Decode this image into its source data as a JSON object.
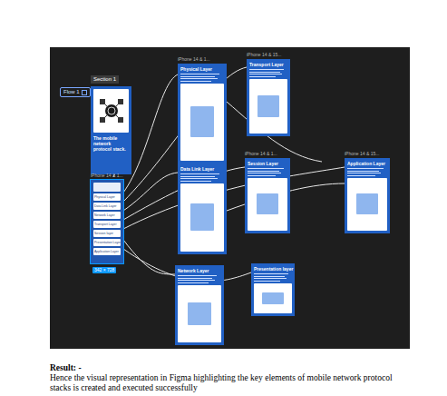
{
  "canvas": {
    "section_label": "Section 1",
    "flow_label": "Flow 1",
    "size_badge": "342 × 728"
  },
  "cover": {
    "title": "The mobile network protocol stack."
  },
  "nav": {
    "label": "iPhone 14 & 1...",
    "selected": true,
    "items": [
      "Physical Layer",
      "Data Link Layer",
      "Network Layer",
      "Transport Layer",
      "Session layer",
      "Presentation Layer",
      "Application Layer"
    ]
  },
  "frames": [
    {
      "label": "iPhone 14 & 1...",
      "title": "Physical Layer"
    },
    {
      "label": "iPhone 14 & 15...",
      "title": "Transport Layer"
    },
    {
      "title": "Data Link Layer"
    },
    {
      "label": "iPhone 14 & 1...",
      "title": "Session Layer"
    },
    {
      "label": "iPhone 14 & 15...",
      "title": "Application Layer"
    },
    {
      "title": "Network Layer"
    },
    {
      "title": "Presentation layer"
    }
  ],
  "result": {
    "heading": "Result: -",
    "text": "Hence the visual representation in Figma highlighting the key elements of mobile network protocol stacks is created and executed successfully"
  }
}
